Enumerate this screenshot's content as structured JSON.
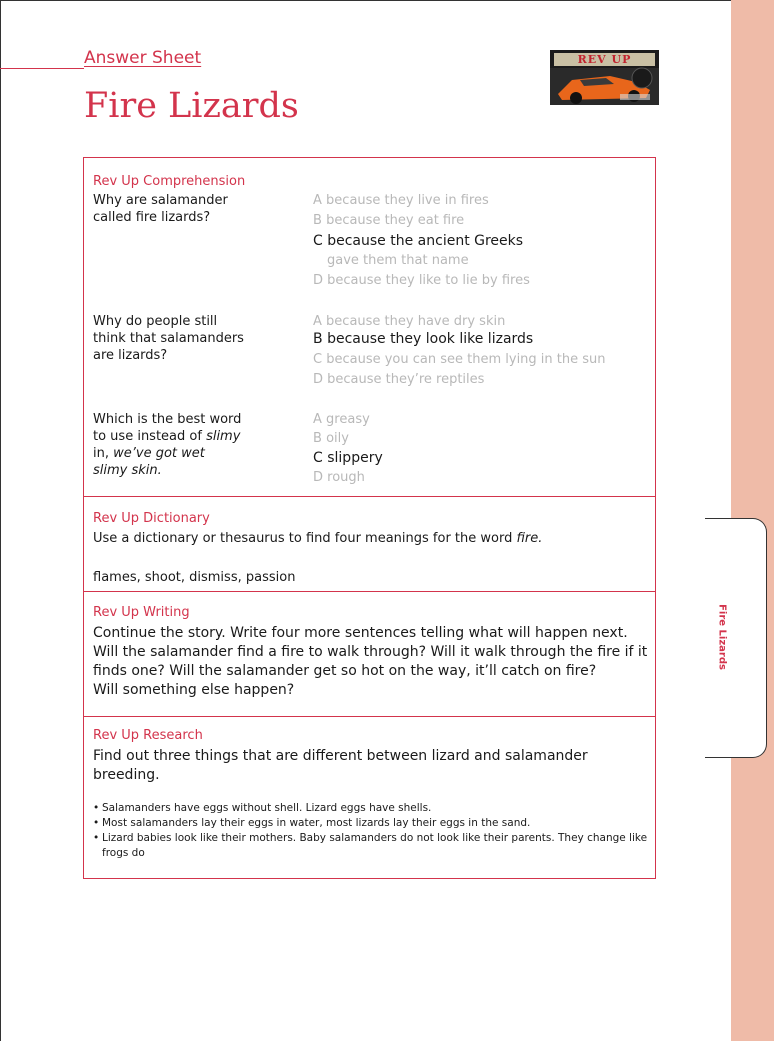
{
  "header": {
    "subtitle": "Answer Sheet",
    "title": "Fire Lizards",
    "logo_text": "REV UP"
  },
  "side_tab": {
    "label": "Fire Lizards"
  },
  "comprehension": {
    "title": "Rev Up Comprehension",
    "questions": [
      {
        "question_lines": [
          "Why are salamander",
          "called fire lizards?"
        ],
        "options": [
          {
            "letter": "A",
            "text": "because they live in fires",
            "selected": false
          },
          {
            "letter": "B",
            "text": "because they eat fire",
            "selected": false
          },
          {
            "letter": "C",
            "text": "because the ancient Greeks",
            "text2": "gave them that name",
            "selected": true
          },
          {
            "letter": "D",
            "text": "because they like to lie by fires",
            "selected": false
          }
        ]
      },
      {
        "question_lines": [
          "Why do people still",
          "think that salamanders",
          "are lizards?"
        ],
        "options": [
          {
            "letter": "A",
            "text": "because they have dry skin",
            "selected": false
          },
          {
            "letter": "B",
            "text": "because they look like lizards",
            "selected": true
          },
          {
            "letter": "C",
            "text": "because you can see them lying in the sun",
            "selected": false
          },
          {
            "letter": "D",
            "text": "because they’re reptiles",
            "selected": false
          }
        ]
      },
      {
        "question_parts": {
          "line1": "Which is the best word",
          "line2_pre": "to use instead of ",
          "line2_em": "slimy",
          "line3_pre": "in, ",
          "line3_em": "we’ve got wet",
          "line4_em": "slimy skin."
        },
        "options": [
          {
            "letter": "A",
            "text": "greasy",
            "selected": false
          },
          {
            "letter": "B",
            "text": "oily",
            "selected": false
          },
          {
            "letter": "C",
            "text": "slippery",
            "selected": true
          },
          {
            "letter": "D",
            "text": "rough",
            "selected": false
          }
        ]
      }
    ]
  },
  "dictionary": {
    "title": "Rev Up Dictionary",
    "prompt_pre": "Use a dictionary or thesaurus to find four meanings for the word ",
    "prompt_em": "fire.",
    "answer": "flames, shoot, dismiss, passion"
  },
  "writing": {
    "title": "Rev Up Writing",
    "lines": [
      "Continue the story.  Write four more sentences telling what will happen next.",
      "Will the salamander find a fire to walk through?  Will it walk through the fire if it",
      "finds one?  Will the salamander get so hot on the way, it’ll catch on fire?",
      "Will something else happen?"
    ]
  },
  "research": {
    "title": "Rev Up Research",
    "prompt_lines": [
      "Find out three things that are different between lizard and salamander",
      "breeding."
    ],
    "answers": [
      "Salamanders have eggs without shell. Lizard eggs have shells.",
      "Most salamanders lay their eggs in water, most lizards lay their eggs in the sand.",
      "Lizard babies look like their mothers. Baby salamanders do not look like their parents. They change like frogs do"
    ]
  },
  "colors": {
    "accent": "#d3344c",
    "side_strip": "#efbba8",
    "dim_text": "#b8b8b8"
  }
}
